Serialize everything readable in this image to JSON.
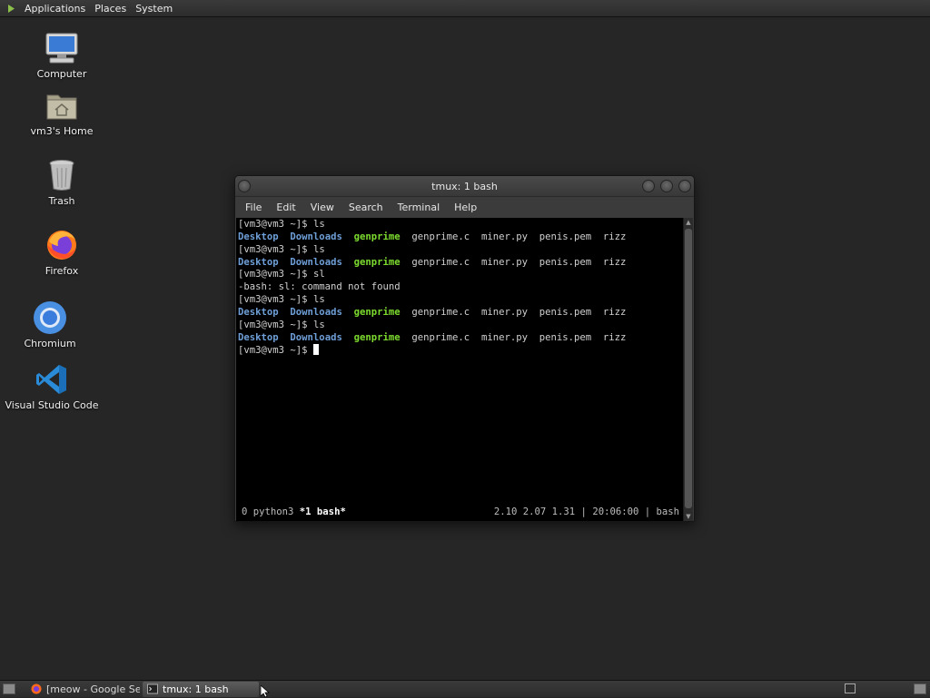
{
  "top_panel": {
    "menus": [
      "Applications",
      "Places",
      "System"
    ]
  },
  "desktop": {
    "icons": [
      {
        "label": "Computer",
        "icon": "computer-icon"
      },
      {
        "label": "vm3's Home",
        "icon": "home-folder-icon"
      },
      {
        "label": "Trash",
        "icon": "trash-icon"
      },
      {
        "label": "Firefox",
        "icon": "firefox-icon"
      },
      {
        "label": "Chromium",
        "icon": "chromium-icon"
      },
      {
        "label": "Visual Studio Code",
        "icon": "vscode-icon"
      }
    ]
  },
  "terminal": {
    "title": "tmux: 1 bash",
    "menu": [
      "File",
      "Edit",
      "View",
      "Search",
      "Terminal",
      "Help"
    ],
    "prompt": "[vm3@vm3 ~]$",
    "commands": [
      "ls",
      "ls",
      "sl",
      "ls",
      "ls"
    ],
    "ls_output": {
      "dirs": [
        "Desktop",
        "Downloads"
      ],
      "exe": "genprime",
      "files": [
        "genprime.c",
        "miner.py",
        "penis.pem",
        "rizz"
      ]
    },
    "error_line": "-bash: sl: command not found",
    "status": {
      "left_window": "0 python3",
      "active_window": "*1 bash*",
      "right": "2.10 2.07 1.31 | 20:06:00 | bash"
    }
  },
  "taskbar": {
    "items": [
      {
        "label": "[meow - Google Se...",
        "active": false
      },
      {
        "label": "tmux: 1 bash",
        "active": true
      }
    ]
  },
  "colors": {
    "desktop_bg": "#262626",
    "dir_color": "#6f9fd8",
    "exe_color": "#7ddc2f",
    "terminal_bg": "#000000"
  }
}
